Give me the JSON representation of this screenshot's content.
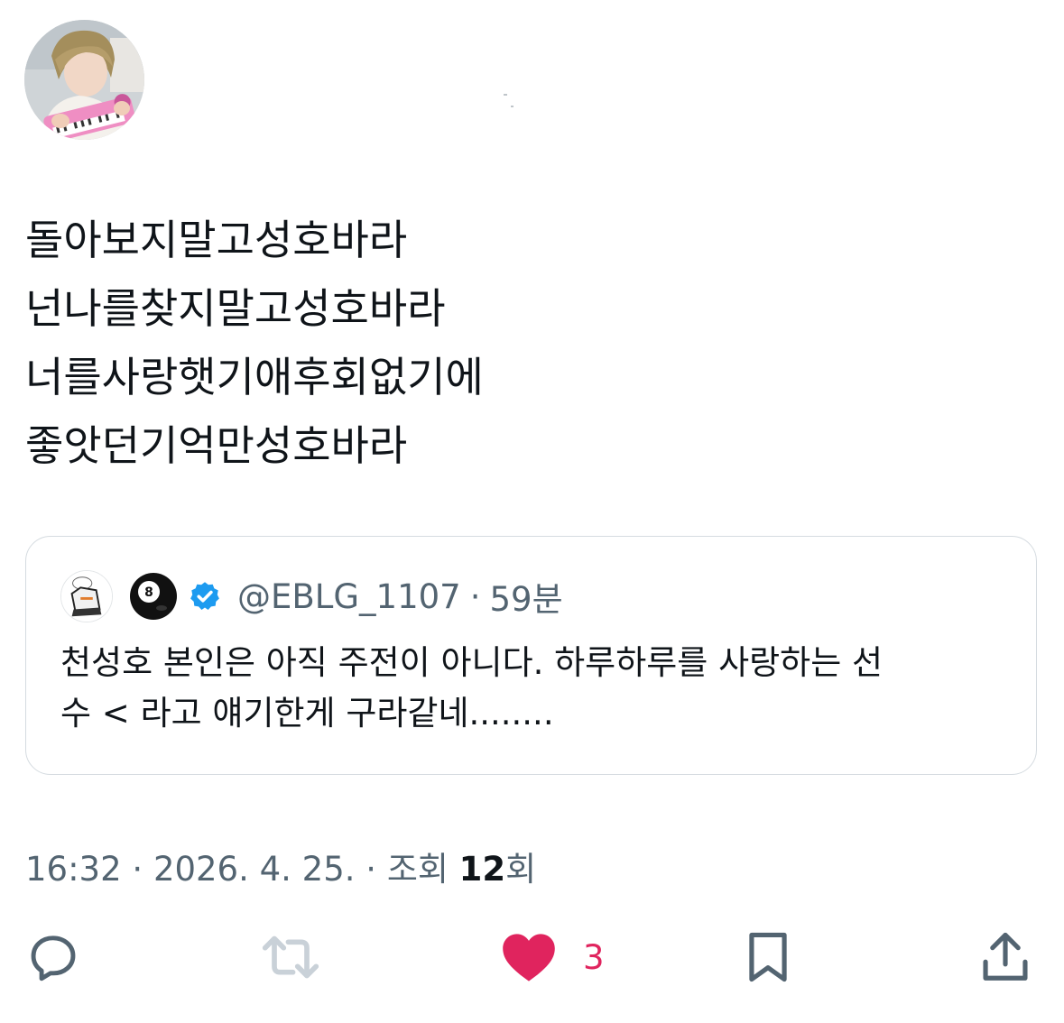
{
  "tweet": {
    "lines": [
      "돌아보지말고성호바라",
      "넌나를찾지말고성호바라",
      "너를사랑햇기애후회없기에",
      "좋앗던기억만성호바라"
    ]
  },
  "quote": {
    "handle": "@EBLG_1107",
    "separator": "·",
    "time": "59분",
    "lines": [
      "천성호 본인은 아직 주전이 아니다. 하루하루를 사랑하는 선",
      "수 < 라고 얘기한게 구라같네........"
    ]
  },
  "meta": {
    "time": "16:32",
    "sep1": " · ",
    "date": "2026. 4. 25.",
    "sep2": " · ",
    "views_label": "조회 ",
    "views_count": "12",
    "views_suffix": "회"
  },
  "actions": {
    "like_count": "3"
  },
  "colors": {
    "text": "#0f1419",
    "secondary": "#536471",
    "like": "#e0245e",
    "verified": "#1d9bf0",
    "border": "#d5dbe0"
  },
  "icons": [
    "reply-icon",
    "retweet-icon",
    "heart-icon",
    "bookmark-icon",
    "share-icon",
    "verified-icon",
    "eight-ball-icon"
  ]
}
